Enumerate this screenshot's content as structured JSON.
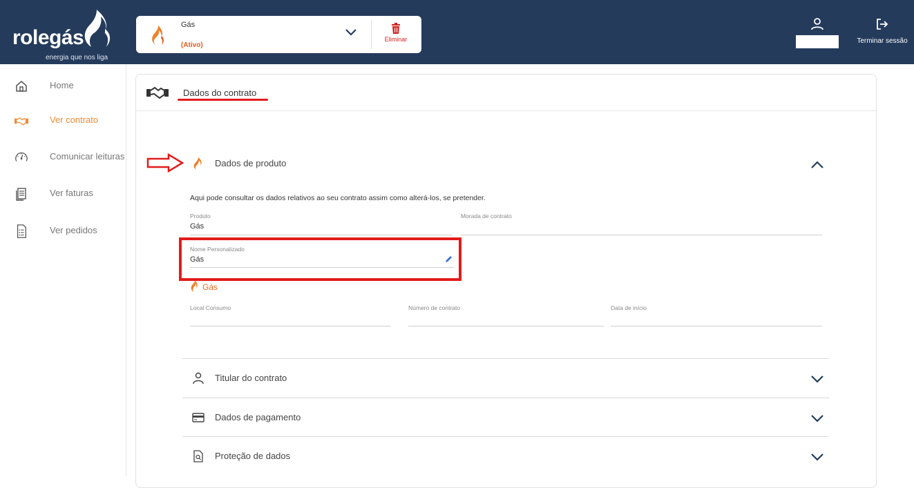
{
  "header": {
    "brand": "rolegás",
    "tagline": "energia que nos liga",
    "product": {
      "name": "Gás",
      "status": "(Ativo)",
      "delete_label": "Eliminar"
    },
    "logout_label": "Terminar sessão"
  },
  "sidebar": {
    "items": [
      {
        "label": "Home",
        "icon": "home-icon"
      },
      {
        "label": "Ver contrato",
        "icon": "handshake-icon",
        "active": true
      },
      {
        "label": "Comunicar leituras",
        "icon": "gauge-icon"
      },
      {
        "label": "Ver faturas",
        "icon": "invoice-icon"
      },
      {
        "label": "Ver pedidos",
        "icon": "list-document-icon"
      }
    ]
  },
  "main": {
    "title": "Dados do contrato",
    "product_section": {
      "title": "Dados de produto",
      "intro": "Aqui pode consultar os dados relativos ao seu contrato assim como alterá-los, se pretender.",
      "fields": {
        "produto": {
          "label": "Produto",
          "value": "Gás"
        },
        "morada": {
          "label": "Morada de contrato",
          "value": ""
        },
        "nome_personalizado": {
          "label": "Nome Personalizado",
          "value": "Gás"
        }
      },
      "sub_product": "Gás",
      "sub_fields": {
        "local_consumo": {
          "label": "Local Consumo",
          "value": ""
        },
        "numero_contrato": {
          "label": "Número de contrato",
          "value": ""
        },
        "data_inicio": {
          "label": "Data de início",
          "value": ""
        }
      }
    },
    "sections": [
      {
        "title": "Titular do contrato",
        "icon": "person-icon"
      },
      {
        "title": "Dados de pagamento",
        "icon": "card-icon"
      },
      {
        "title": "Proteção de dados",
        "icon": "document-search-icon"
      }
    ]
  },
  "colors": {
    "header_bg": "#243b5c",
    "accent_orange": "#f08a35",
    "alert_red": "#e21b1b"
  }
}
